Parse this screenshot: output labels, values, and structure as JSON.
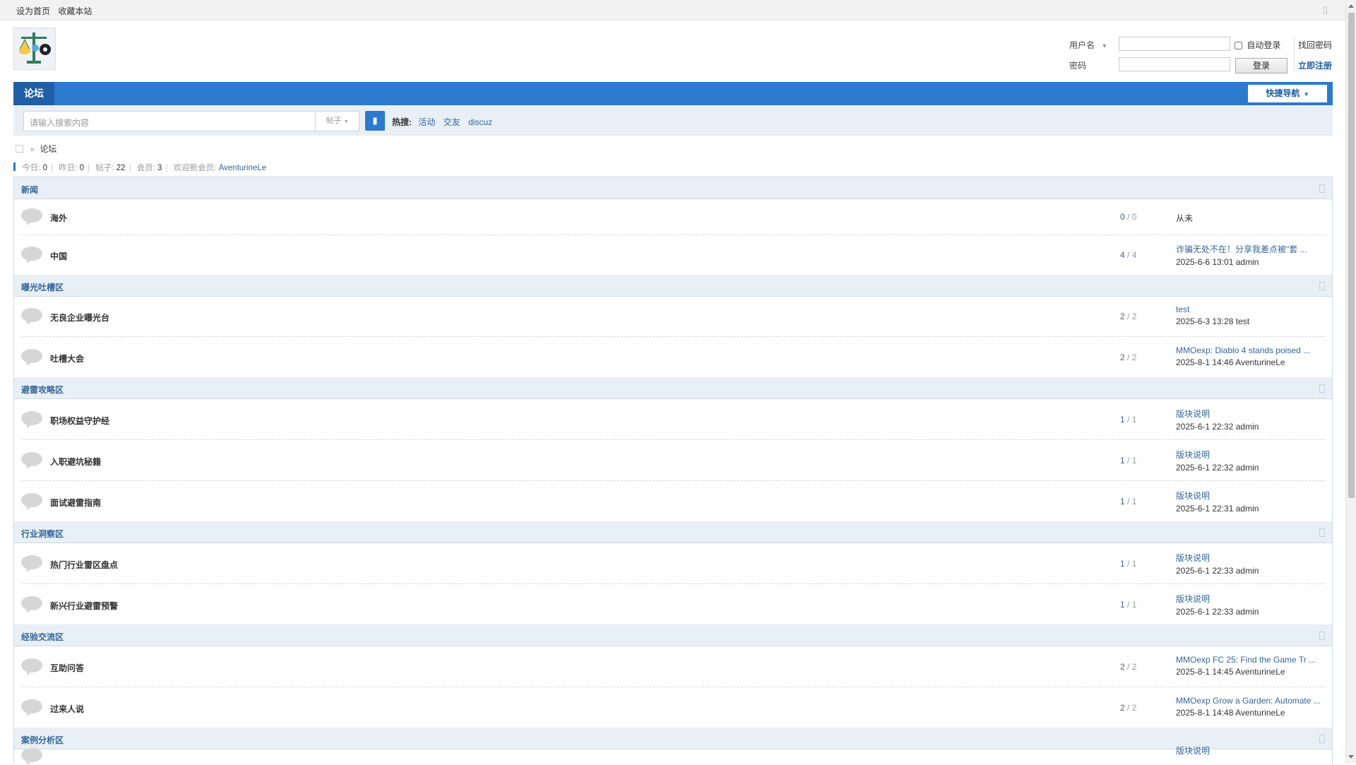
{
  "topbar": {
    "set_home": "设为首页",
    "bookmark": "收藏本站"
  },
  "login": {
    "username_label": "用户名",
    "password_label": "密码",
    "auto_login": "自动登录",
    "login_button": "登录",
    "find_password": "找回密码",
    "register": "立即注册"
  },
  "nav": {
    "forum_tab": "论坛",
    "quick_nav": "快捷导航"
  },
  "search": {
    "placeholder": "请输入搜索内容",
    "type": "帖子",
    "hot_label": "热搜:",
    "hot_terms": [
      "活动",
      "交友",
      "discuz"
    ]
  },
  "breadcrumb": {
    "separator": "»",
    "current": "论坛"
  },
  "stats": {
    "today_label": "今日:",
    "today": "0",
    "yesterday_label": "昨日:",
    "yesterday": "0",
    "posts_label": "帖子:",
    "posts": "22",
    "members_label": "会员:",
    "members": "3",
    "welcome_label": "欢迎新会员:",
    "newest_member": "AventurineLe"
  },
  "categories": [
    {
      "title": "新闻",
      "forums": [
        {
          "name": "海外",
          "threads": "0",
          "posts": "0",
          "last_title": "",
          "last_meta": "",
          "never": "从未"
        },
        {
          "name": "中国",
          "threads": "4",
          "posts": "4",
          "last_title": "诈骗无处不在！分享我差点被\"套 ...",
          "last_meta": "2025-6-6 13:01 admin"
        }
      ]
    },
    {
      "title": "曝光吐槽区",
      "forums": [
        {
          "name": "无良企业曝光台",
          "threads": "2",
          "posts": "2",
          "last_title": "test",
          "last_meta": "2025-6-3 13:28 test"
        },
        {
          "name": "吐槽大会",
          "threads": "2",
          "posts": "2",
          "last_title": "MMOexp: Diablo 4 stands poised ...",
          "last_meta": "2025-8-1 14:46 AventurineLe"
        }
      ]
    },
    {
      "title": "避雷攻略区",
      "forums": [
        {
          "name": "职场权益守护经",
          "threads": "1",
          "posts": "1",
          "last_title": "版块说明",
          "last_meta": "2025-6-1 22:32 admin"
        },
        {
          "name": "入职避坑秘籍",
          "threads": "1",
          "posts": "1",
          "last_title": "版块说明",
          "last_meta": "2025-6-1 22:32 admin"
        },
        {
          "name": "面试避雷指南",
          "threads": "1",
          "posts": "1",
          "last_title": "版块说明",
          "last_meta": "2025-6-1 22:31 admin"
        }
      ]
    },
    {
      "title": "行业洞察区",
      "forums": [
        {
          "name": "热门行业雷区盘点",
          "threads": "1",
          "posts": "1",
          "last_title": "版块说明",
          "last_meta": "2025-6-1 22:33 admin"
        },
        {
          "name": "新兴行业避雷预警",
          "threads": "1",
          "posts": "1",
          "last_title": "版块说明",
          "last_meta": "2025-6-1 22:33 admin"
        }
      ]
    },
    {
      "title": "经验交流区",
      "forums": [
        {
          "name": "互助问答",
          "threads": "2",
          "posts": "2",
          "last_title": "MMOexp FC 25: Find the Game Tr ...",
          "last_meta": "2025-8-1 14:45 AventurineLe"
        },
        {
          "name": "过来人说",
          "threads": "2",
          "posts": "2",
          "last_title": "MMOexp Grow a Garden: Automate ...",
          "last_meta": "2025-8-1 14:48 AventurineLe"
        }
      ]
    },
    {
      "title": "案例分析区",
      "forums": [
        {
          "name": "",
          "threads": "",
          "posts": "",
          "last_title": "版块说明",
          "last_meta": ""
        }
      ]
    }
  ]
}
